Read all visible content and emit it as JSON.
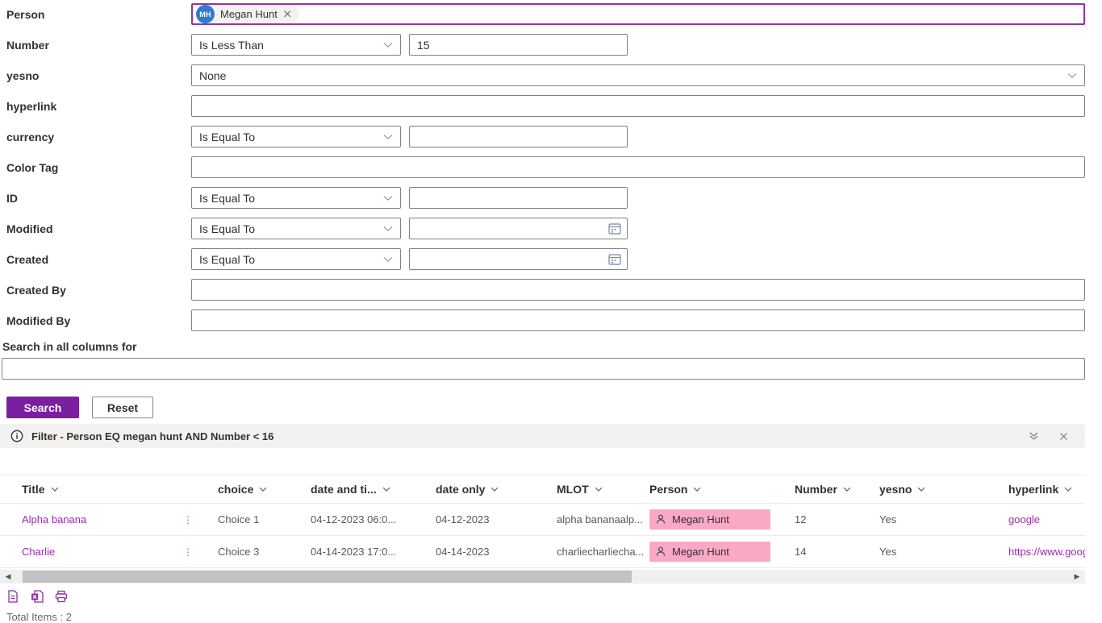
{
  "colors": {
    "accent": "#7b1fa2",
    "link": "#9c2bad",
    "person_pill_bg": "#f9a8c6",
    "avatar_bg": "#2b7cd3",
    "message_bar_bg": "#f3f2f1",
    "input_border": "#818181",
    "focused_border": "#9333a4",
    "row_divider": "#edebe9"
  },
  "icons": {
    "more": "⋮",
    "scroll_left": "◀",
    "scroll_right": "▶"
  },
  "form": {
    "rows": [
      {
        "label": "Person",
        "type": "people",
        "value": "Megan Hunt",
        "initials": "MH"
      },
      {
        "label": "Number",
        "type": "op-value",
        "operator": "Is Less Than",
        "value": "15"
      },
      {
        "label": "yesno",
        "type": "select",
        "value": "None"
      },
      {
        "label": "hyperlink",
        "type": "text",
        "value": ""
      },
      {
        "label": "currency",
        "type": "op-value",
        "operator": "Is Equal To",
        "value": ""
      },
      {
        "label": "Color Tag",
        "type": "text",
        "value": ""
      },
      {
        "label": "ID",
        "type": "op-value",
        "operator": "Is Equal To",
        "value": ""
      },
      {
        "label": "Modified",
        "type": "op-date",
        "operator": "Is Equal To",
        "value": ""
      },
      {
        "label": "Created",
        "type": "op-date",
        "operator": "Is Equal To",
        "value": ""
      },
      {
        "label": "Created By",
        "type": "text",
        "value": ""
      },
      {
        "label": "Modified By",
        "type": "text",
        "value": ""
      }
    ],
    "search_all_label": "Search in all columns for",
    "search_all_value": "",
    "search_button": "Search",
    "reset_button": "Reset"
  },
  "filter_bar": {
    "text": "Filter - Person EQ megan hunt AND Number < 16"
  },
  "table": {
    "columns": [
      "Title",
      "choice",
      "date and ti...",
      "date only",
      "MLOT",
      "Person",
      "Number",
      "yesno",
      "hyperlink"
    ],
    "rows": [
      {
        "title": "Alpha banana",
        "choice": "Choice 1",
        "datetime": "04-12-2023 06:0...",
        "dateonly": "04-12-2023",
        "mlot": "alpha bananaalp...",
        "person": "Megan Hunt",
        "number": "12",
        "yesno": "Yes",
        "hyperlink": "google"
      },
      {
        "title": "Charlie",
        "choice": "Choice 3",
        "datetime": "04-14-2023 17:0...",
        "dateonly": "04-14-2023",
        "mlot": "charliecharliecha...",
        "person": "Megan Hunt",
        "number": "14",
        "yesno": "Yes",
        "hyperlink": "https://www.goog"
      }
    ]
  },
  "footer": {
    "total_items": "Total Items : 2"
  }
}
